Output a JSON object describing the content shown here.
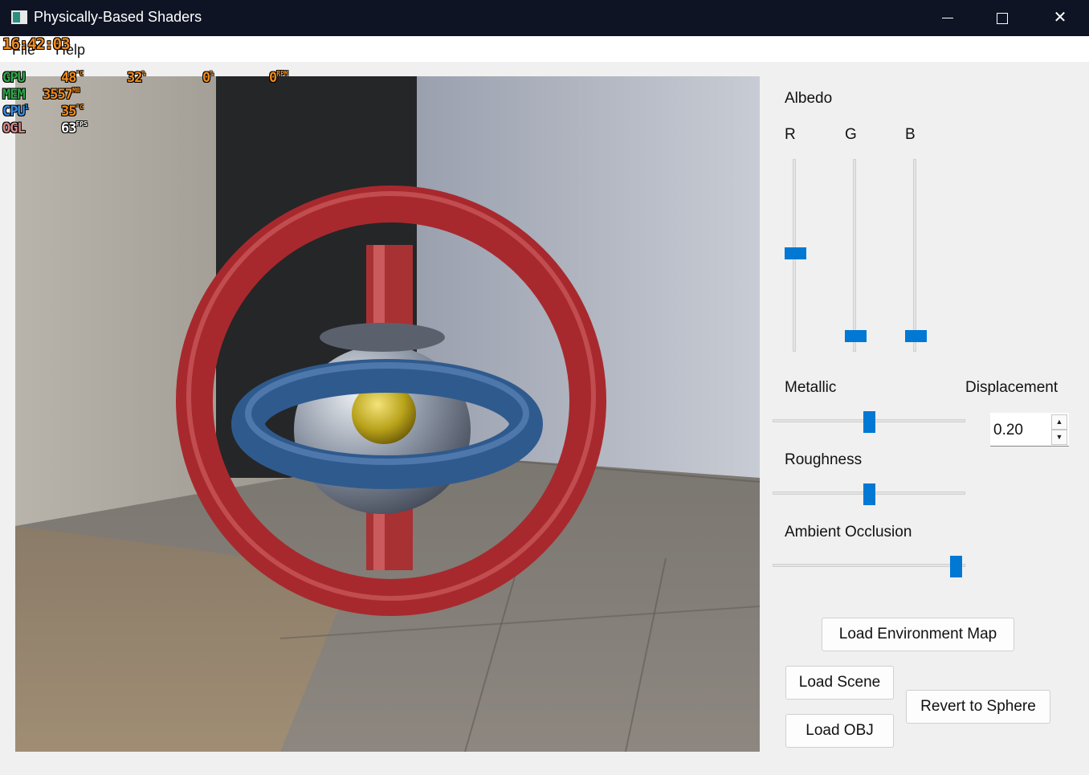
{
  "window": {
    "title": "Physically-Based Shaders"
  },
  "menu": {
    "items": [
      {
        "label": "File"
      },
      {
        "label": "Help"
      }
    ]
  },
  "overlay": {
    "time": "16:42:03",
    "gpu": {
      "label": "GPU",
      "temp": "48",
      "temp_unit": "°C",
      "load": "32",
      "load_unit": "%",
      "v3": "0",
      "v3_unit": "%",
      "fan": "0",
      "fan_unit": "RPM"
    },
    "mem": {
      "label": "MEM",
      "value": "3557",
      "unit": "MB"
    },
    "cpu": {
      "label": "CPU",
      "sub": "1",
      "temp": "35",
      "unit": "°C"
    },
    "ogl": {
      "label": "OGL",
      "fps": "63",
      "unit": "FPS"
    }
  },
  "controls": {
    "albedo": {
      "label": "Albedo",
      "r_label": "R",
      "g_label": "G",
      "b_label": "B",
      "r_value": 0.5,
      "g_value": 0.04,
      "b_value": 0.04
    },
    "metallic": {
      "label": "Metallic",
      "value": 0.5
    },
    "roughness": {
      "label": "Roughness",
      "value": 0.5
    },
    "ao": {
      "label": "Ambient Occlusion",
      "value": 0.98
    },
    "displacement": {
      "label": "Displacement",
      "value": "0.20"
    },
    "buttons": {
      "load_env": "Load Environment Map",
      "load_scene": "Load Scene",
      "load_obj": "Load OBJ",
      "revert": "Revert to Sphere"
    }
  },
  "colors": {
    "accent": "#0078d4",
    "titlebar": "#0f1424",
    "overlay_orange": "#f08a1a",
    "overlay_green": "#2fa84a",
    "overlay_blue": "#3a8fe0",
    "overlay_pink": "#d88a8a"
  }
}
